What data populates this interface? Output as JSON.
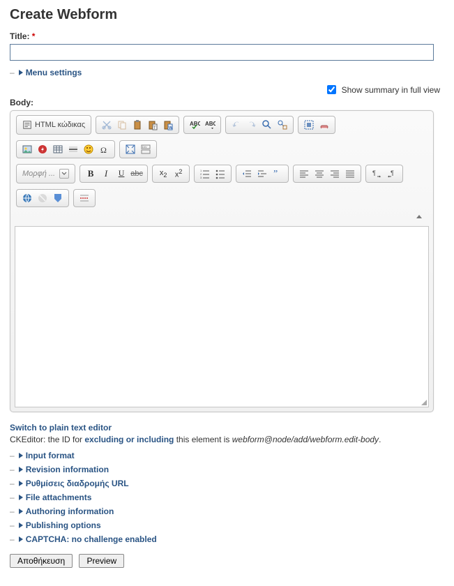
{
  "page": {
    "title": "Create Webform"
  },
  "title_field": {
    "label": "Title:",
    "required": "*",
    "value": ""
  },
  "menu_settings": {
    "label": "Menu settings"
  },
  "summary": {
    "label": "Show summary in full view",
    "checked": true
  },
  "body": {
    "label": "Body:",
    "source_label": "HTML κώδικας",
    "format_placeholder": "Μορφή ..."
  },
  "hint": {
    "switch": "Switch to plain text editor",
    "prefix": "CKEditor: the ID for ",
    "link": "excluding or including",
    "mid": " this element is ",
    "path": "webform@node/add/webform.edit-body",
    "suffix": "."
  },
  "fieldsets": [
    {
      "label": "Input format"
    },
    {
      "label": "Revision information"
    },
    {
      "label": "Ρυθμίσεις διαδρομής URL"
    },
    {
      "label": "File attachments"
    },
    {
      "label": "Authoring information"
    },
    {
      "label": "Publishing options"
    },
    {
      "label": "CAPTCHA: no challenge enabled"
    }
  ],
  "buttons": {
    "save": "Αποθήκευση",
    "preview": "Preview"
  }
}
